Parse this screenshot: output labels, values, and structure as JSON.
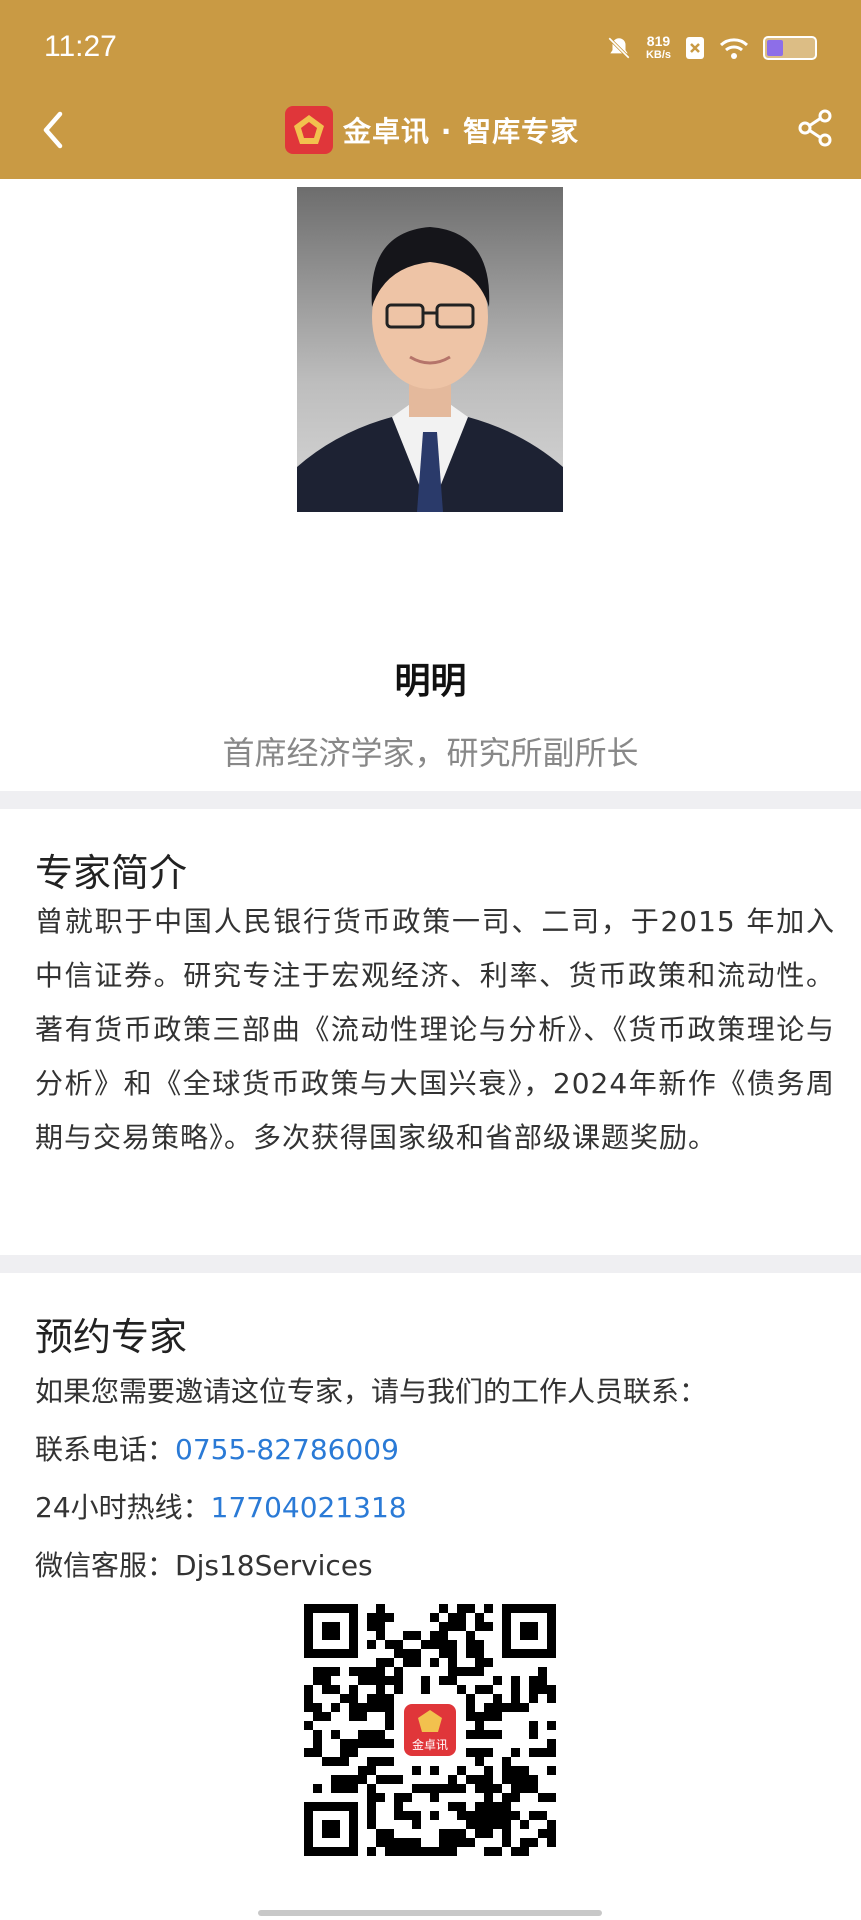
{
  "status_bar": {
    "time": "11:27",
    "net_speed_value": "819",
    "net_speed_unit": "KB/s"
  },
  "nav": {
    "title": "金卓讯 · 智库专家",
    "icons": [
      "back-arrow-icon",
      "app-logo-icon",
      "share-icon"
    ]
  },
  "profile": {
    "name": "明明",
    "title": "首席经济学家，研究所副所长"
  },
  "intro": {
    "heading": "专家简介",
    "body": "曾就职于中国人民银行货币政策一司、二司，于2015 年加入中信证券。研究专注于宏观经济、利率、货币政策和流动性。著有货币政策三部曲《流动性理论与分析》、《货币政策理论与分析》和《全球货币政策与大国兴衰》，2024年新作《债务周期与交易策略》。多次获得国家级和省部级课题奖励。"
  },
  "booking": {
    "heading": "预约专家",
    "invite_text": "如果您需要邀请这位专家，请与我们的工作人员联系：",
    "phone_label": "联系电话：",
    "phone_value": "0755-82786009",
    "hotline_label": "24小时热线：",
    "hotline_value": "17704021318",
    "wechat_label": "微信客服：",
    "wechat_value": "Djs18Services",
    "qr_logo_text": "金卓讯"
  },
  "colors": {
    "header_bg": "#C99A44",
    "link": "#2a7ad6",
    "logo_red": "#E0363A"
  }
}
